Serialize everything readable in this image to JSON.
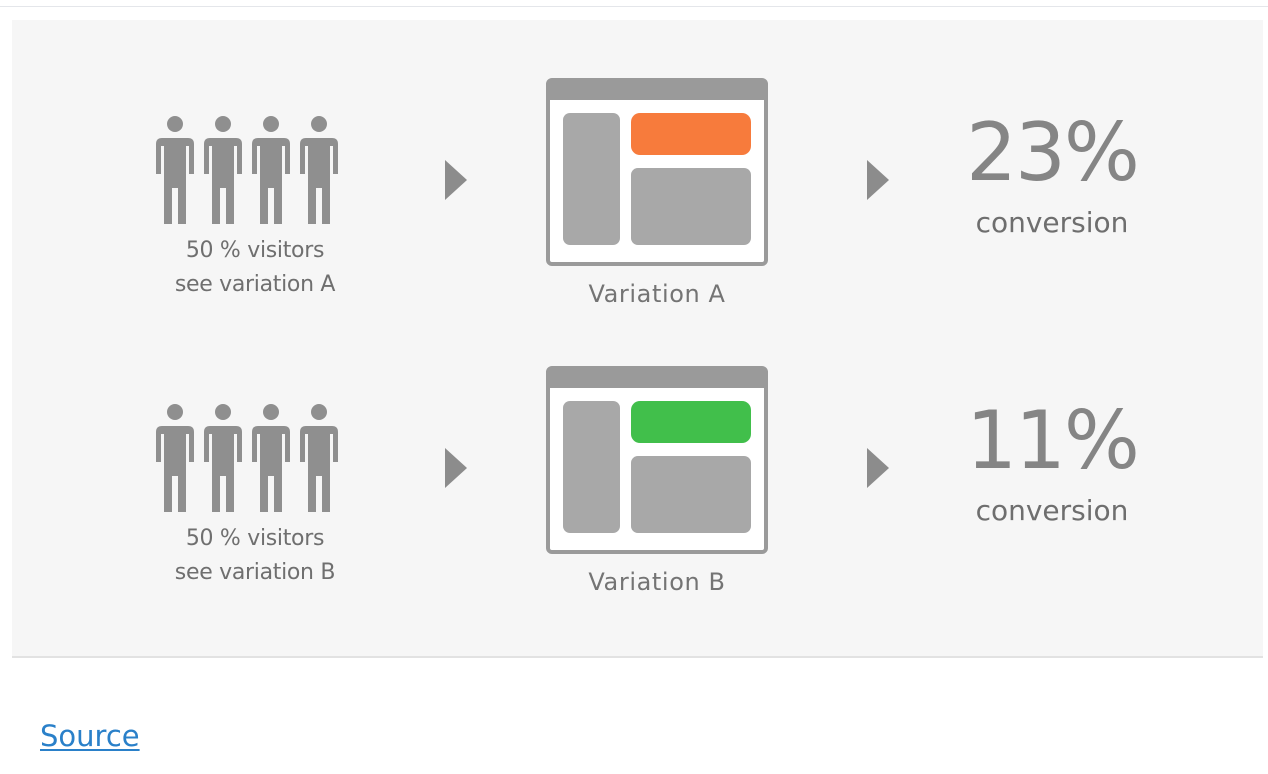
{
  "diagram": {
    "rows": [
      {
        "id": "a",
        "visitor_line_1": "50 % visitors",
        "visitor_line_2": "see variation A",
        "variation_label": "Variation A",
        "cta_color": "#f77b3c",
        "rate": "23%",
        "conversion_label": "conversion"
      },
      {
        "id": "b",
        "visitor_line_1": "50 % visitors",
        "visitor_line_2": "see variation B",
        "variation_label": "Variation B",
        "cta_color": "#41bf4b",
        "rate": "11%",
        "conversion_label": "conversion"
      }
    ],
    "icons": {
      "people": "person-group-icon",
      "arrow": "arrow-right-icon",
      "page": "page-layout-icon"
    },
    "colors": {
      "figure_gray": "#9a9a9a",
      "text_gray": "#6f6f6f"
    }
  },
  "footer": {
    "source_label": "Source",
    "link_color": "#2a80c9"
  }
}
